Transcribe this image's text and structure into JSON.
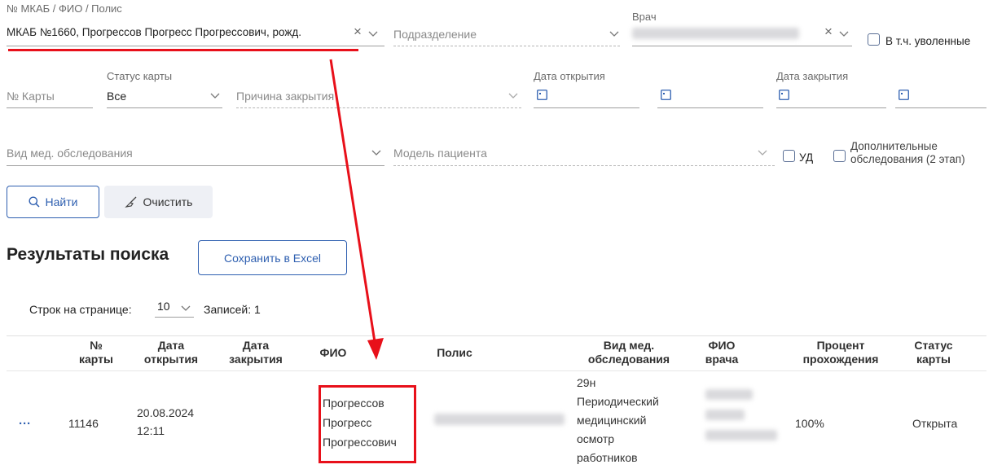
{
  "filters": {
    "mkab": {
      "label": "№ МКАБ / ФИО / Полис",
      "value": "МКАБ №1660, Прогрессов Прогресс Прогрессович, рожд."
    },
    "department": {
      "placeholder": "Подразделение"
    },
    "doctor": {
      "label": "Врач"
    },
    "include_dismissed": {
      "label": "В т.ч. уволенные"
    },
    "card_number": {
      "placeholder": "№ Карты"
    },
    "card_status": {
      "label": "Статус карты",
      "value": "Все"
    },
    "close_reason": {
      "placeholder": "Причина закрытия"
    },
    "open_date": {
      "label": "Дата открытия"
    },
    "close_date": {
      "label": "Дата закрытия"
    },
    "exam_type": {
      "placeholder": "Вид мед. обследования"
    },
    "patient_model": {
      "placeholder": "Модель пациента"
    },
    "ud": {
      "label": "УД"
    },
    "extra_exams": {
      "label_line1": "Дополнительные",
      "label_line2": "обследования (2 этап)"
    }
  },
  "actions": {
    "find_label": "Найти",
    "clear_label": "Очистить"
  },
  "results": {
    "title": "Результаты поиска",
    "excel_label": "Сохранить в Excel",
    "rows_per_page_label": "Строк на странице:",
    "rows_per_page_value": "10",
    "records_label": "Записей: 1"
  },
  "table": {
    "headers": [
      "№\nкарты",
      "Дата\nоткрытия",
      "Дата\nзакрытия",
      "ФИО",
      "Полис",
      "Вид мед.\nобследования",
      "ФИО\nврача",
      "Процент\nпрохождения",
      "Статус\nкарты"
    ],
    "row": {
      "menu": "···",
      "card_number": "11146",
      "open_date": "20.08.2024\n12:11",
      "close_date": "",
      "fio": "Прогрессов\nПрогресс\nПрогрессович",
      "exam_type": "29н\nПериодический\nмедицинский\nосмотр\nработников",
      "percent": "100%",
      "status": "Открыта"
    }
  },
  "colors": {
    "accent": "#2e5fb0",
    "annotation": "#e8101a"
  }
}
